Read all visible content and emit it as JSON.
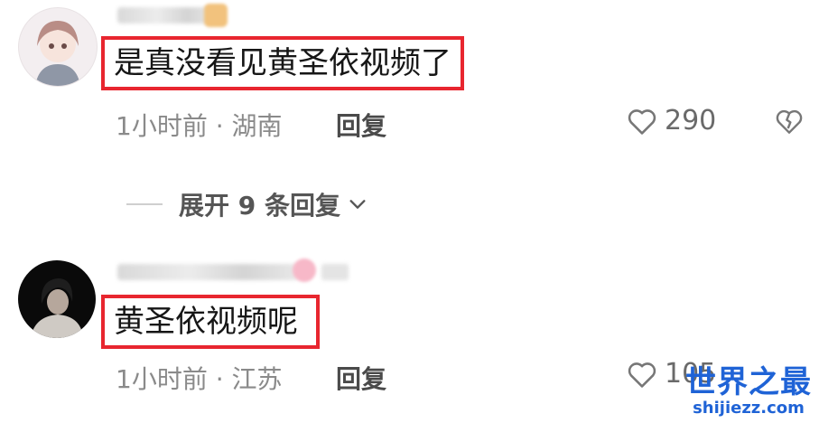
{
  "comments": [
    {
      "text": "是真没看见黄圣依视频了",
      "time_location": "1小时前 · 湖南",
      "reply_label": "回复",
      "likes": "290"
    },
    {
      "text": "黄圣依视频呢",
      "time_location": "1小时前 · 江苏",
      "reply_label": "回复",
      "likes": "105"
    }
  ],
  "expand_replies": "展开 9 条回复",
  "watermark": {
    "main": "世界之最",
    "sub": "shijiezz.com"
  },
  "colors": {
    "highlight_border": "#e8262f",
    "watermark": "#1f63d6"
  }
}
